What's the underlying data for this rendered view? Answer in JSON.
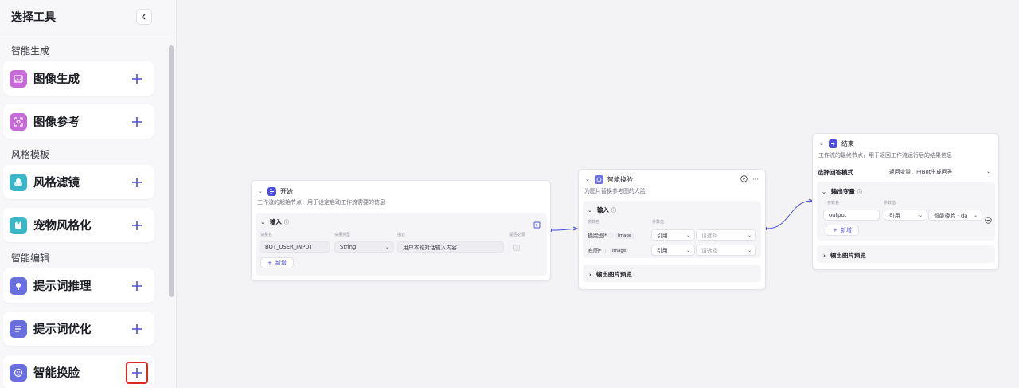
{
  "sidebar": {
    "title": "选择工具",
    "groups": [
      {
        "title": "智能生成",
        "items": [
          {
            "label": "图像生成",
            "icon": "image-generate-icon",
            "color": "#c56ad6"
          },
          {
            "label": "图像参考",
            "icon": "image-reference-icon",
            "color": "#c56ad6"
          }
        ]
      },
      {
        "title": "风格模板",
        "items": [
          {
            "label": "风格滤镜",
            "icon": "style-filter-icon",
            "color": "#3bb6c9"
          },
          {
            "label": "宠物风格化",
            "icon": "pet-style-icon",
            "color": "#3bb6c9"
          }
        ]
      },
      {
        "title": "智能编辑",
        "items": [
          {
            "label": "提示词推理",
            "icon": "prompt-reason-icon",
            "color": "#6a6fe0"
          },
          {
            "label": "提示词优化",
            "icon": "prompt-optimize-icon",
            "color": "#6a6fe0"
          },
          {
            "label": "智能换脸",
            "icon": "face-swap-icon",
            "color": "#6a6fe0"
          }
        ]
      }
    ]
  },
  "nodes": {
    "start": {
      "title": "开始",
      "desc": "工作流的起始节点，用于设定启动工作流需要的信息",
      "input_title": "输入",
      "col_name": "变量名",
      "col_type": "变量类型",
      "col_desc": "描述",
      "col_required": "是否必要",
      "var_name": "BOT_USER_INPUT",
      "var_type": "String",
      "var_desc": "用户本轮对话输入内容",
      "add_label": "新增"
    },
    "faceswap": {
      "title": "智能换脸",
      "desc": "为图片替换参考图的人脸",
      "input_title": "输入",
      "col_name": "参数名",
      "col_value": "参数值",
      "row1_label": "换脸图*",
      "row2_label": "底图*",
      "tag": "Image",
      "ref": "引用",
      "placeholder": "请选择",
      "preview": "输出图片预览"
    },
    "end": {
      "title": "结束",
      "desc": "工作流的最终节点，用于返回工作流运行后的结果信息",
      "mode_label": "选择回答模式",
      "mode_value": "返回变量，由Bot生成回答",
      "output_title": "输出变量",
      "col_name": "参数名",
      "col_value": "参数值",
      "var_name": "output",
      "ref": "引用",
      "ref_value": "智能换脸 - da",
      "add_label": "新增",
      "preview": "输出图片预览"
    }
  }
}
